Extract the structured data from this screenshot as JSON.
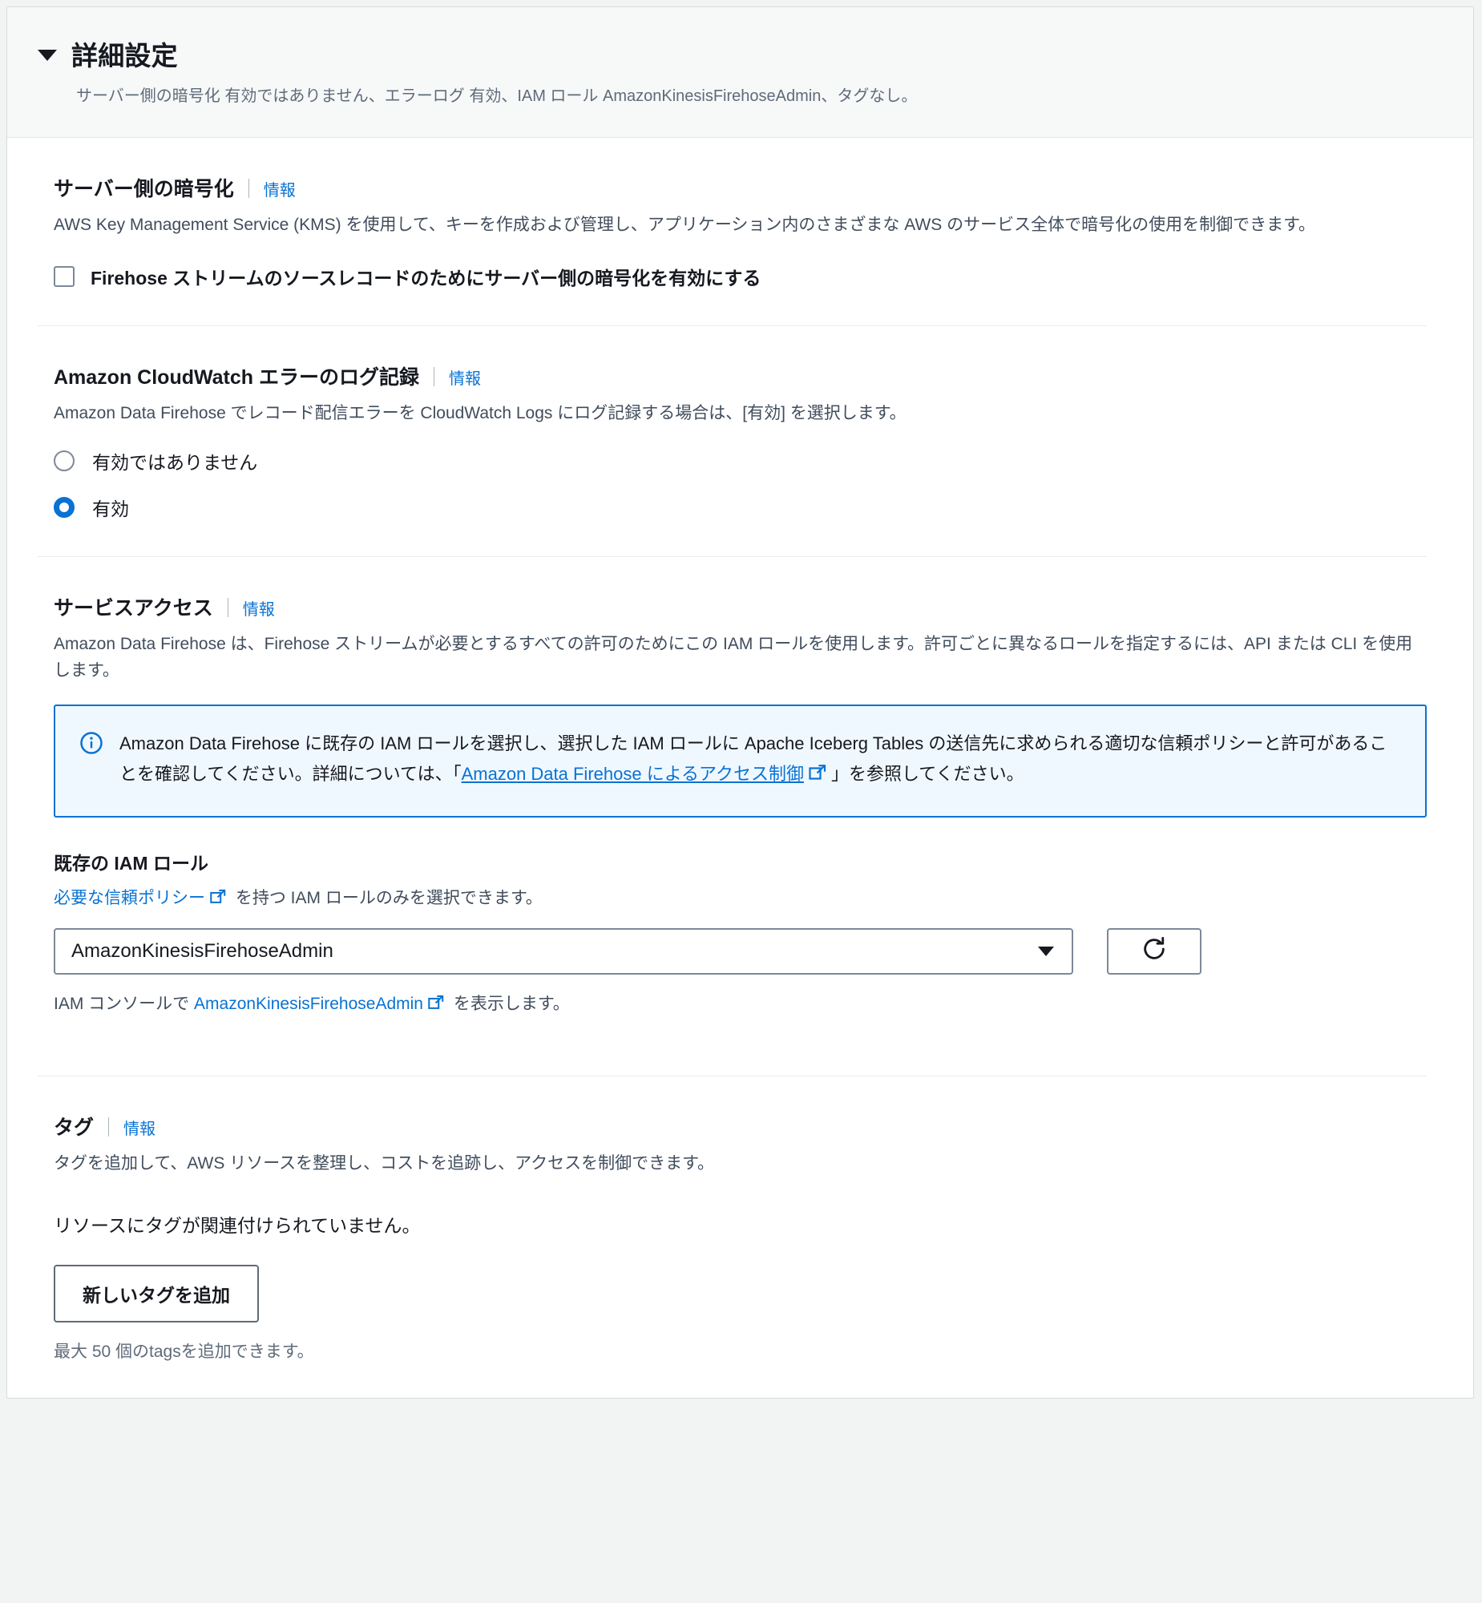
{
  "header": {
    "title": "詳細設定",
    "summary": "サーバー側の暗号化 有効ではありません、エラーログ 有効、IAM ロール AmazonKinesisFirehoseAdmin、タグなし。",
    "caret_icon": "caret-down-icon"
  },
  "encryption": {
    "title": "サーバー側の暗号化",
    "info_label": "情報",
    "description": "AWS Key Management Service (KMS) を使用して、キーを作成および管理し、アプリケーション内のさまざまな AWS のサービス全体で暗号化の使用を制御できます。",
    "checkbox_label": "Firehose ストリームのソースレコードのためにサーバー側の暗号化を有効にする",
    "checkbox_checked": false
  },
  "cloudwatch": {
    "title": "Amazon CloudWatch エラーのログ記録",
    "info_label": "情報",
    "description": "Amazon Data Firehose でレコード配信エラーを CloudWatch Logs にログ記録する場合は、[有効] を選択します。",
    "options": [
      {
        "label": "有効ではありません",
        "selected": false
      },
      {
        "label": "有効",
        "selected": true
      }
    ]
  },
  "service_access": {
    "title": "サービスアクセス",
    "info_label": "情報",
    "description": "Amazon Data Firehose は、Firehose ストリームが必要とするすべての許可のためにこの IAM ロールを使用します。許可ごとに異なるロールを指定するには、API または CLI を使用します。",
    "alert": {
      "icon": "info-circle-icon",
      "text_part1": "Amazon Data Firehose に既存の IAM ロールを選択し、選択した IAM ロールに Apache Iceberg Tables の送信先に求められる適切な信頼ポリシーと許可があることを確認してください。詳細については、「",
      "link_text": "Amazon Data Firehose によるアクセス制御",
      "text_part2": "」を参照してください。"
    },
    "iam_role": {
      "label": "既存の IAM ロール",
      "hint_link": "必要な信頼ポリシー",
      "hint_rest": " を持つ IAM ロールのみを選択できます。",
      "selected_value": "AmazonKinesisFirehoseAdmin",
      "options": [
        "AmazonKinesisFirehoseAdmin"
      ],
      "dropdown_icon": "caret-down-icon",
      "refresh_icon": "refresh-icon",
      "footnote_prefix": "IAM コンソールで ",
      "footnote_link": "AmazonKinesisFirehoseAdmin",
      "footnote_suffix": " を表示します。"
    }
  },
  "tags": {
    "title": "タグ",
    "info_label": "情報",
    "description": "タグを追加して、AWS リソースを整理し、コストを追跡し、アクセスを制御できます。",
    "empty_message": "リソースにタグが関連付けられていません。",
    "add_button": "新しいタグを追加",
    "limit_note": "最大 50 個のtagsを追加できます。"
  },
  "colors": {
    "accent": "#0972d3",
    "alert_bg": "#f0f8ff",
    "header_bg": "#f7f8f8",
    "text": "#16191f",
    "muted": "#414d5c",
    "border": "#d5dbdb"
  }
}
